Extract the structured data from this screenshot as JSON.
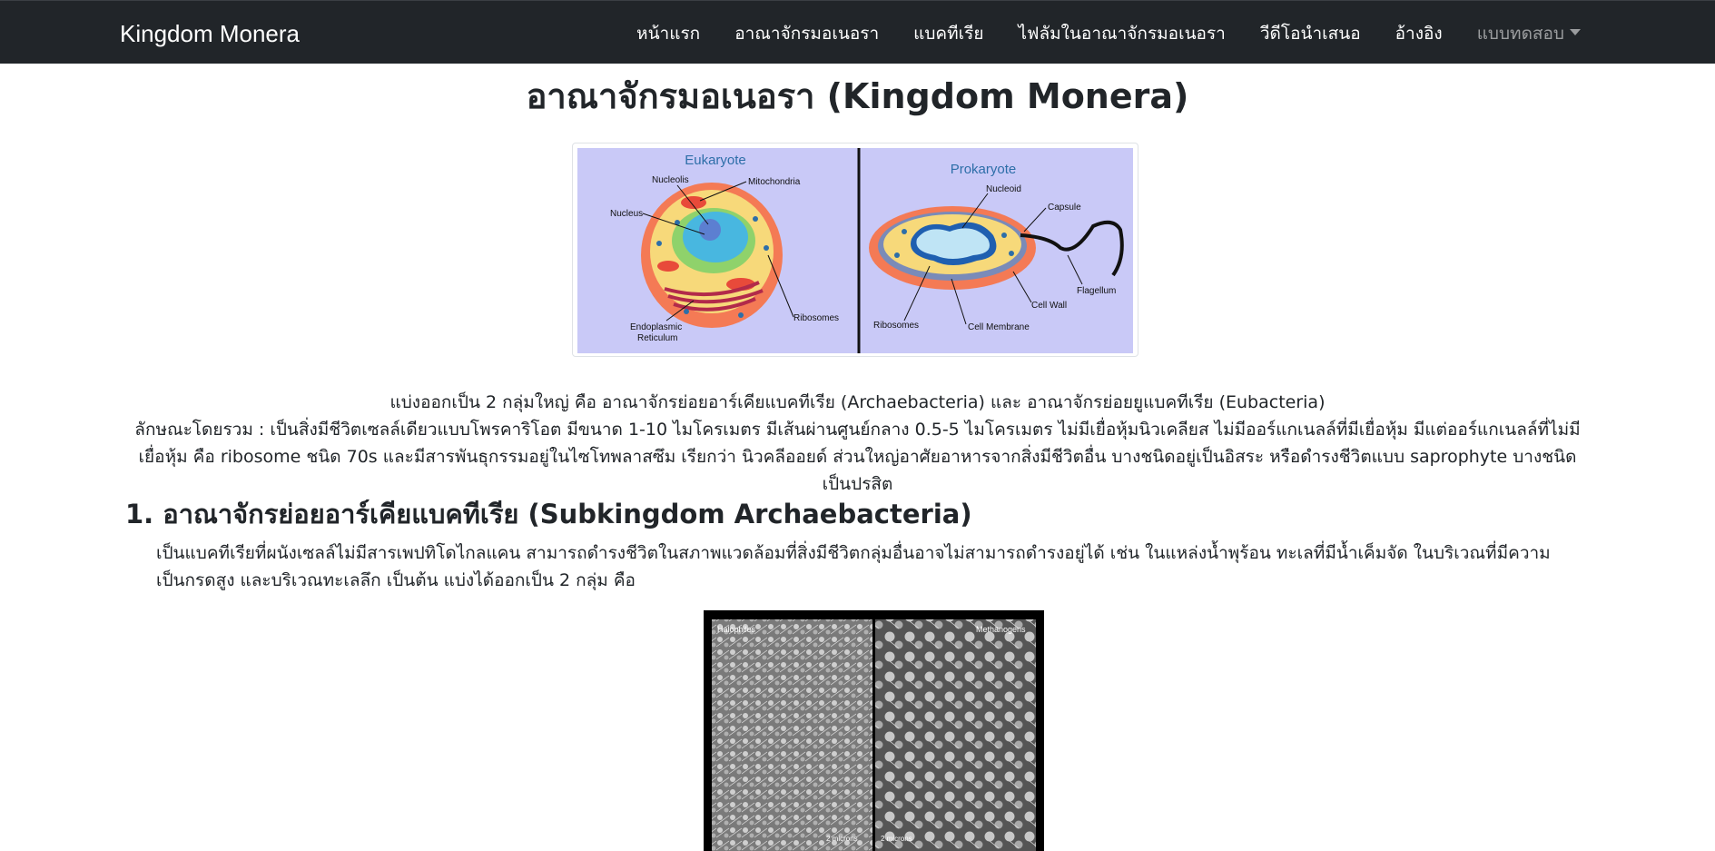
{
  "navbar": {
    "brand": "Kingdom Monera",
    "items": [
      {
        "label": "หน้าแรก"
      },
      {
        "label": "อาณาจักรมอเนอรา"
      },
      {
        "label": "แบคทีเรีย"
      },
      {
        "label": "ไฟลัมในอาณาจักรมอเนอรา"
      },
      {
        "label": "วีดีโอนำเสนอ"
      },
      {
        "label": "อ้างอิง"
      }
    ],
    "dropdown": {
      "label": "แบบทดสอบ"
    }
  },
  "main": {
    "title": "อาณาจักรมอเนอรา (Kingdom Monera)",
    "cell_figure": {
      "eukaryote": {
        "title": "Eukaryote",
        "labels": [
          "Nucleolis",
          "Mitochondria",
          "Nucleus",
          "Endoplasmic",
          "Reticulum",
          "Ribosomes"
        ]
      },
      "prokaryote": {
        "title": "Prokaryote",
        "labels": [
          "Nucleoid",
          "Capsule",
          "Flagellum",
          "Cell Wall",
          "Ribosomes",
          "Cell Membrane"
        ]
      }
    },
    "intro_line1": "แบ่งออกเป็น 2 กลุ่มใหญ่ คือ อาณาจักรย่อยอาร์เคียแบคทีเรีย (Archaebacteria) และ อาณาจักรย่อยยูแบคทีเรีย (Eubacteria)",
    "intro_line2": "ลักษณะโดยรวม : เป็นสิ่งมีชีวิตเซลล์เดียวแบบโพรคาริโอต มีขนาด 1-10 ไมโครเมตร มีเส้นผ่านศูนย์กลาง 0.5-5 ไมโครเมตร ไม่มีเยื่อหุ้มนิวเคลียส ไม่มีออร์แกเนลล์ที่มีเยื่อหุ้ม มีแต่ออร์แกเนลล์ที่ไม่มีเยื่อหุ้ม คือ ribosome ชนิด 70s และมีสารพันธุกรรมอยู่ในไซโทพลาสซึม เรียกว่า นิวคลีออยด์ ส่วนใหญ่อาศัยอาหารจากสิ่งมีชีวิตอื่น บางชนิดอยู่เป็นอิสระ หรือดำรงชีวิตแบบ saprophyte บางชนิดเป็นปรสิต",
    "section1": {
      "heading": "1. อาณาจักรย่อยอาร์เคียแบคทีเรีย (Subkingdom Archaebacteria)",
      "body": "เป็นแบคทีเรียที่ผนังเซลล์ไม่มีสารเพปทิโดไกลแคน สามารถดำรงชีวิตในสภาพแวดล้อมที่สิ่งมีชีวิตกลุ่มอื่นอาจไม่สามารถดำรงอยู่ได้ เช่น ในแหล่งน้ำพุร้อน ทะเลที่มีน้ำเค็มจัด ในบริเวณที่มีความเป็นกรดสูง และบริเวณทะเลลึก เป็นต้น แบ่งได้ออกเป็น 2 กลุ่ม คือ",
      "micrograph": {
        "left_label": "Halophiles",
        "right_label": "Methanogens",
        "left_scale": "2 microns",
        "right_scale": "2 microns"
      }
    }
  },
  "colors": {
    "navbar_bg": "#212529",
    "figure_bg": "#c9c9f7",
    "figure_title": "#2d6ea8"
  }
}
